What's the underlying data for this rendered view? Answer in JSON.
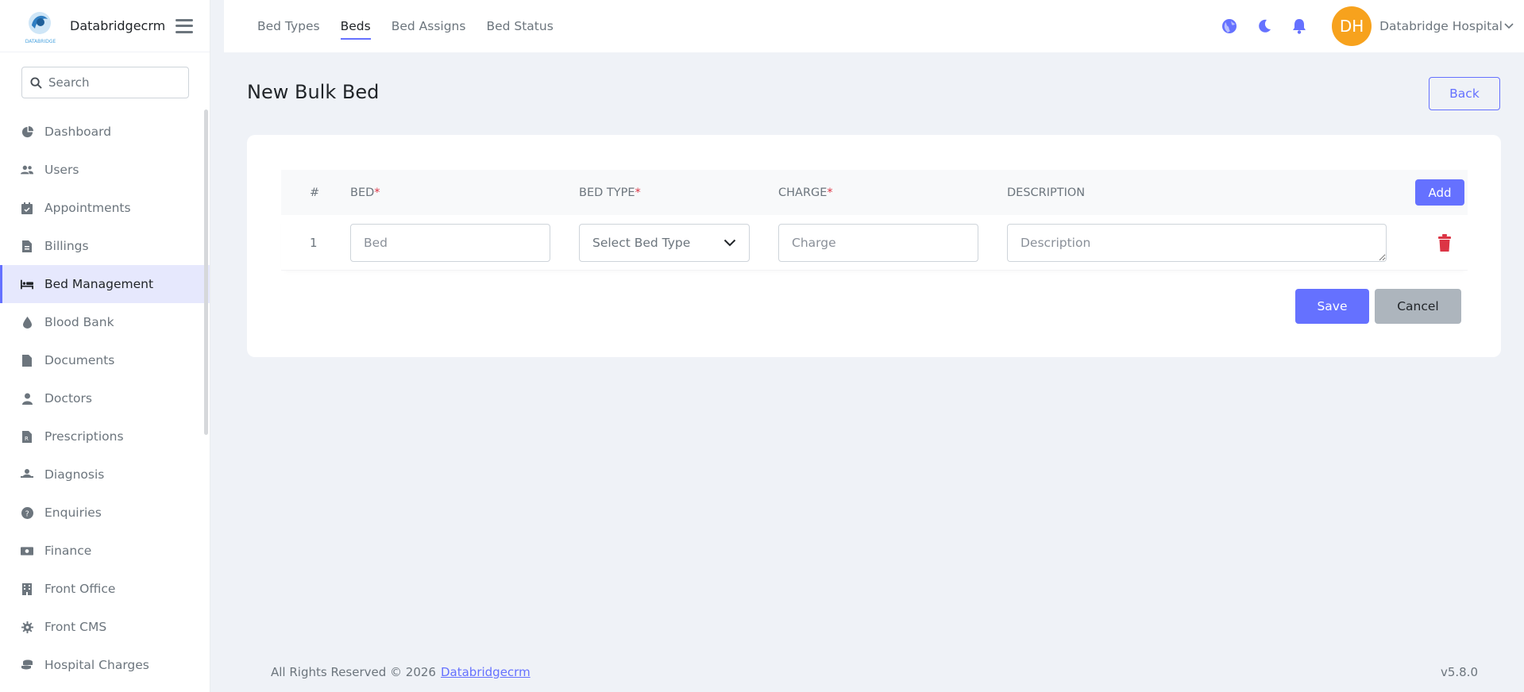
{
  "brand": {
    "name": "Databridgecrm",
    "logo_text": "DATABRIDGE"
  },
  "search": {
    "placeholder": "Search"
  },
  "sidebar": {
    "items": [
      {
        "label": "Dashboard",
        "icon": "pie-chart-icon"
      },
      {
        "label": "Users",
        "icon": "users-icon"
      },
      {
        "label": "Appointments",
        "icon": "calendar-check-icon"
      },
      {
        "label": "Billings",
        "icon": "file-invoice-icon"
      },
      {
        "label": "Bed Management",
        "icon": "bed-icon",
        "active": true
      },
      {
        "label": "Blood Bank",
        "icon": "blood-drop-icon"
      },
      {
        "label": "Documents",
        "icon": "file-icon"
      },
      {
        "label": "Doctors",
        "icon": "doctor-icon"
      },
      {
        "label": "Prescriptions",
        "icon": "prescription-icon"
      },
      {
        "label": "Diagnosis",
        "icon": "diagnosis-icon"
      },
      {
        "label": "Enquiries",
        "icon": "question-circle-icon"
      },
      {
        "label": "Finance",
        "icon": "money-bill-icon"
      },
      {
        "label": "Front Office",
        "icon": "building-icon"
      },
      {
        "label": "Front CMS",
        "icon": "gear-icon"
      },
      {
        "label": "Hospital Charges",
        "icon": "coins-icon"
      }
    ]
  },
  "topnav": {
    "tabs": [
      {
        "label": "Bed Types"
      },
      {
        "label": "Beds",
        "active": true
      },
      {
        "label": "Bed Assigns"
      },
      {
        "label": "Bed Status"
      }
    ],
    "user_initials": "DH",
    "user_name": "Databridge Hospital"
  },
  "page": {
    "title": "New Bulk Bed",
    "back_label": "Back"
  },
  "table": {
    "headers": {
      "num": "#",
      "bed": "BED",
      "bed_type": "BED TYPE",
      "charge": "CHARGE",
      "description": "DESCRIPTION",
      "required_mark": "*"
    },
    "add_label": "Add",
    "rows": [
      {
        "num": "1",
        "bed_placeholder": "Bed",
        "bed_type_placeholder": "Select Bed Type",
        "charge_placeholder": "Charge",
        "description_placeholder": "Description"
      }
    ]
  },
  "actions": {
    "save_label": "Save",
    "cancel_label": "Cancel"
  },
  "footer": {
    "copyright": "All Rights Reserved © 2026",
    "link": "Databridgecrm",
    "version": "v5.8.0"
  },
  "colors": {
    "primary": "#6571ff",
    "avatar": "#f7a21d",
    "danger": "#dc3545",
    "active_bg": "#e6e8fd",
    "page_bg": "#eff2f7"
  }
}
